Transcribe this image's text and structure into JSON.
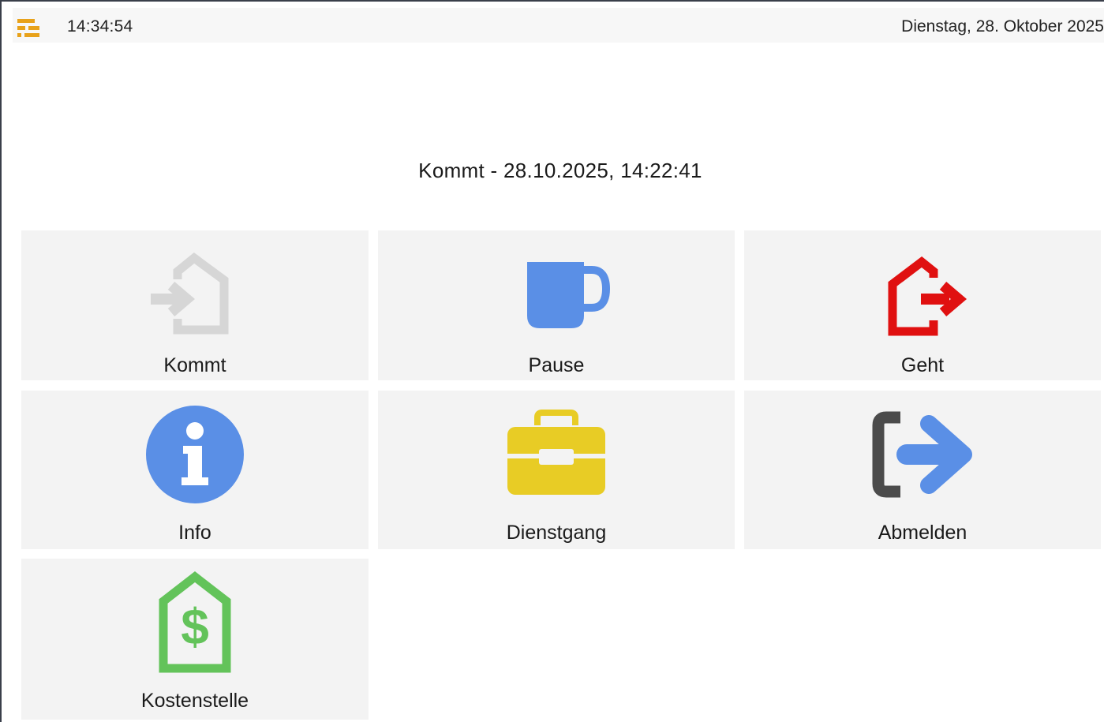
{
  "header": {
    "time": "14:34:54",
    "date": "Dienstag, 28. Oktober 2025",
    "logo_icon": "app-logo-icon",
    "logo_color": "#e8a21b"
  },
  "status": {
    "last_booking": "Kommt - 28.10.2025, 14:22:41"
  },
  "tiles": [
    {
      "label": "Kommt",
      "icon": "arrive-icon",
      "color": "#d6d6d6",
      "enabled": false
    },
    {
      "label": "Pause",
      "icon": "coffee-mug-icon",
      "color": "#5a8fe6"
    },
    {
      "label": "Geht",
      "icon": "leave-icon",
      "color": "#e01010"
    },
    {
      "label": "Info",
      "icon": "info-icon",
      "color": "#5a8fe6"
    },
    {
      "label": "Dienstgang",
      "icon": "briefcase-icon",
      "color": "#e8cc25"
    },
    {
      "label": "Abmelden",
      "icon": "logout-icon",
      "color": "#5a8fe6"
    },
    {
      "label": "Kostenstelle",
      "icon": "cost-center-icon",
      "color": "#63c35a"
    }
  ]
}
